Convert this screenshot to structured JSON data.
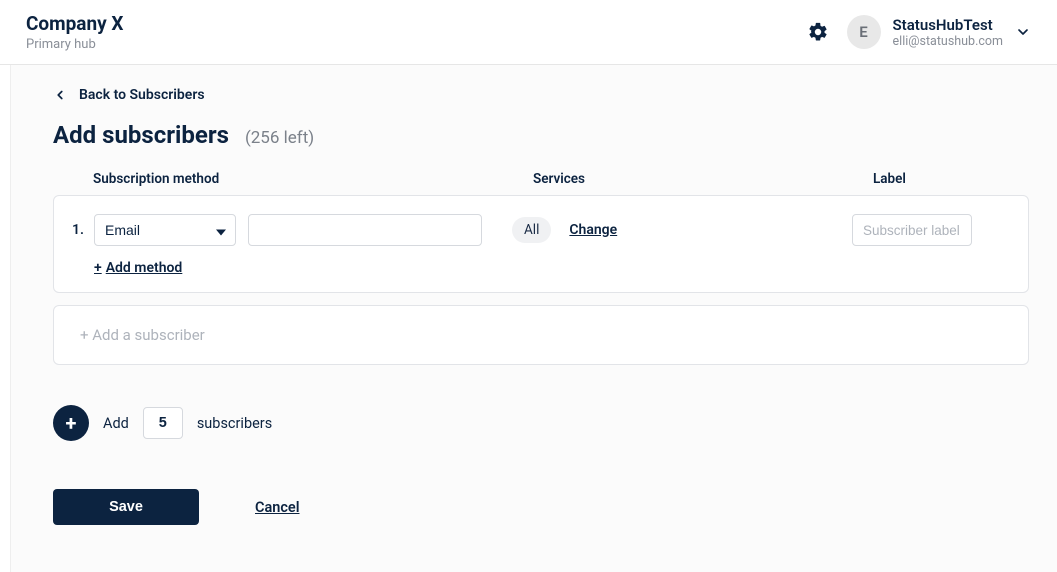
{
  "header": {
    "company_name": "Company X",
    "company_subtitle": "Primary hub",
    "avatar_initial": "E",
    "user_name": "StatusHubTest",
    "user_email": "elli@statushub.com"
  },
  "page": {
    "back_label": "Back to Subscribers",
    "title": "Add subscribers",
    "remaining": "(256 left)"
  },
  "columns": {
    "method": "Subscription method",
    "services": "Services",
    "label": "Label"
  },
  "row": {
    "index": "1.",
    "method_selected": "Email",
    "method_value": "",
    "services_pill": "All",
    "services_change": "Change",
    "label_placeholder": "Subscriber label",
    "add_method_plus": "+",
    "add_method_text": " Add method"
  },
  "add_subscriber_card": "+ Add a subscriber",
  "bulk": {
    "add_label": "Add",
    "qty": "5",
    "suffix": "subscribers"
  },
  "footer": {
    "save": "Save",
    "cancel": "Cancel"
  }
}
